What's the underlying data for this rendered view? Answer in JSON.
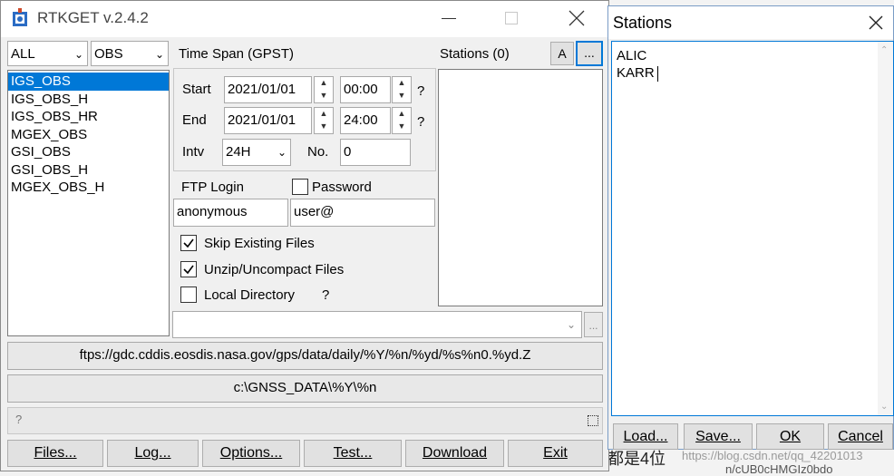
{
  "rtkget": {
    "title": "RTKGET v.2.4.2",
    "data_type_select": "ALL",
    "obs_type_select": "OBS",
    "data_types": [
      "IGS_OBS",
      "IGS_OBS_H",
      "IGS_OBS_HR",
      "MGEX_OBS",
      "GSI_OBS",
      "GSI_OBS_H",
      "MGEX_OBS_H"
    ],
    "selected_index": 0,
    "time_span_label": "Time Span (GPST)",
    "start_label": "Start",
    "start_date": "2021/01/01",
    "start_time": "00:00",
    "end_label": "End",
    "end_date": "2021/01/01",
    "end_time": "24:00",
    "help_q": "?",
    "intv_label": "Intv",
    "intv_value": "24H",
    "no_label": "No.",
    "no_value": "0",
    "stations_label": "Stations (0)",
    "stations_a_btn": "A",
    "stations_more_btn": "...",
    "ftp_login_label": "FTP Login",
    "password_label": "Password",
    "login_value": "anonymous",
    "password_value": "user@",
    "skip_existing_label": "Skip Existing Files",
    "unzip_label": "Unzip/Uncompact Files",
    "local_dir_label": "Local Directory",
    "local_dir_help": "?",
    "url": "ftps://gdc.cddis.eosdis.nasa.gov/gps/data/daily/%Y/%n/%yd/%s%n0.%yd.Z",
    "local_path": "c:\\GNSS_DATA\\%Y\\%n",
    "status_text": "?",
    "small_btn": "...",
    "buttons": {
      "files": "Files...",
      "log": "Log...",
      "options": "Options...",
      "test": "Test...",
      "download": "Download",
      "exit": "Exit"
    }
  },
  "stations_dialog": {
    "title": "Stations",
    "text_lines": [
      "ALIC",
      "KARR"
    ],
    "buttons": {
      "load": "Load...",
      "save": "Save...",
      "ok": "OK",
      "cancel": "Cancel"
    }
  },
  "background": {
    "text_1": "都是4位",
    "text_2": "https://blog.csdn.net/qq_42201013",
    "text_3": "n/cUB0cHMGIz0bdo"
  }
}
